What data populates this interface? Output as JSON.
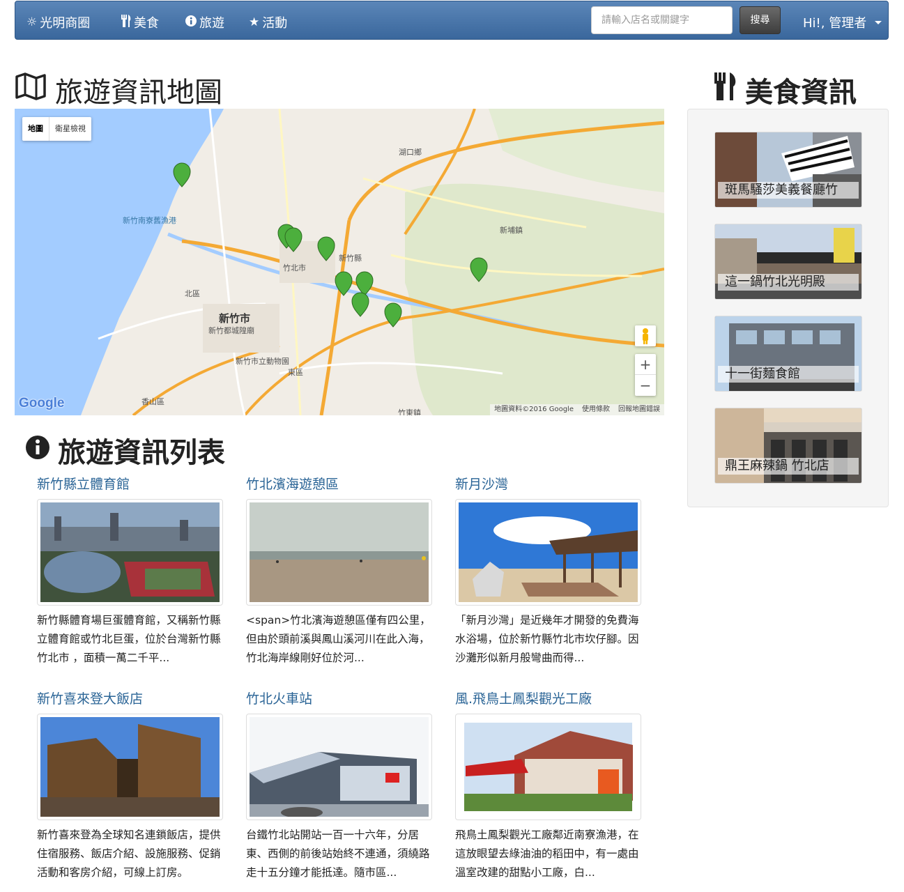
{
  "navbar": {
    "brand": "光明商圈",
    "items": [
      {
        "label": "美食",
        "icon": "cutlery-icon"
      },
      {
        "label": "旅遊",
        "icon": "info-circle-icon"
      },
      {
        "label": "活動",
        "icon": "star-icon"
      }
    ],
    "search_placeholder": "請輸入店名或關鍵字",
    "search_button": "搜尋",
    "user_menu": "Hi!, 管理者"
  },
  "map_section": {
    "title": "旅遊資訊地圖",
    "map_type_options": [
      "地圖",
      "衛星檢視"
    ],
    "selected_map_type": "地圖",
    "zoom_in": "+",
    "zoom_out": "−",
    "google_logo": "Google",
    "footer": [
      "地圖資料©2016 Google",
      "使用條款",
      "回報地圖錯誤"
    ],
    "labels": {
      "hsinchu_city": "新竹市",
      "zhubei_city": "竹北市",
      "xinpu_town": "新埔鎮",
      "north_district": "北區",
      "east_district": "東區",
      "xiangshan": "香山區",
      "hukou": "湖口鄉",
      "harbor": "新竹南寮舊漁港",
      "zoo": "新竹市立動物園",
      "dushi": "新竹都城隍廟",
      "hsinchu_county": "新竹縣",
      "zhudong": "竹東鎮"
    }
  },
  "food_section": {
    "title": "美食資訊",
    "items": [
      {
        "name": "斑馬騷莎美義餐廳竹"
      },
      {
        "name": "這一鍋竹北光明殿"
      },
      {
        "name": "十一街麵食館"
      },
      {
        "name": "鼎王麻辣鍋 竹北店"
      }
    ]
  },
  "list_section": {
    "title": "旅遊資訊列表",
    "items": [
      {
        "title": "新竹縣立體育館",
        "desc": "新竹縣體育場巨蛋體育館，又稱新竹縣立體育館或竹北巨蛋，位於台灣新竹縣竹北市 ，面積一萬二千平..."
      },
      {
        "title": "竹北濱海遊憩區",
        "desc": "<span>竹北濱海遊憩區僅有四公里，但由於頭前溪與鳳山溪河川在此入海，竹北海岸線剛好位於河..."
      },
      {
        "title": "新月沙灣",
        "desc": "「新月沙灣」是近幾年才開發的免費海水浴場，位於新竹縣竹北市坎仔腳。因沙灘形似新月般彎曲而得..."
      },
      {
        "title": "新竹喜來登大飯店",
        "desc": "新竹喜來登為全球知名連鎖飯店，提供住宿服務、飯店介紹、設施服務、促銷活動和客房介紹，可線上訂房。"
      },
      {
        "title": "竹北火車站",
        "desc": "台鐵竹北站開站一百一十六年，分居東、西側的前後站始終不連通，須繞路走十五分鐘才能抵達。隨市區..."
      },
      {
        "title": "風.飛鳥土鳳梨觀光工廠",
        "desc": "飛鳥土鳳梨觀光工廠鄰近南寮漁港，在這放眼望去綠油油的稻田中，有一處由溫室改建的甜點小工廠，白..."
      }
    ]
  }
}
